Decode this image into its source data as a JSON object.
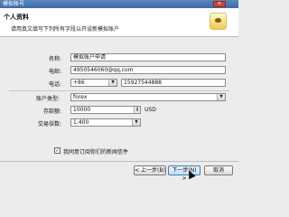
{
  "window": {
    "title": "模拟帐号",
    "close_symbol": "×"
  },
  "header": {
    "title": "个人资料",
    "description": "请用真文填写下列所有字段以开设新模拟账户"
  },
  "form": {
    "name": {
      "label": "名称:",
      "value": "模拟账户申请"
    },
    "email": {
      "label": "电邮:",
      "value": "4950546060@qq.com"
    },
    "phone": {
      "label": "电话:",
      "country_code": "+86",
      "value": "15927544888"
    },
    "account_type": {
      "label": "账户类型:",
      "value": "forex"
    },
    "deposit": {
      "label": "存款额:",
      "value": "10000",
      "currency": "USD"
    },
    "leverage": {
      "label": "交易倍数:",
      "value": "1:400"
    },
    "subscribe": {
      "label": "我同意订阅你们的新闻信件",
      "checked": true,
      "check_mark": "✓"
    }
  },
  "footer": {
    "back_label": "< 上一步(B)",
    "next_label": "下一步(N) >",
    "cancel_label": "取消"
  }
}
